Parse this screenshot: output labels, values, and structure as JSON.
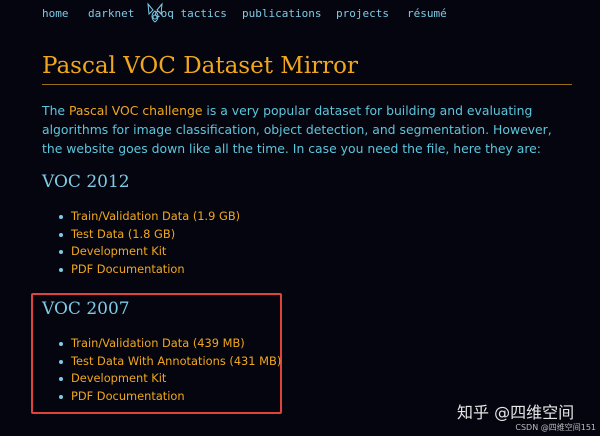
{
  "nav": {
    "items": [
      "home",
      "darknet",
      "coq tactics",
      "publications",
      "projects",
      "résumé"
    ]
  },
  "page": {
    "title": "Pascal VOC Dataset Mirror",
    "intro_prefix": "The ",
    "intro_link": "Pascal VOC challenge",
    "intro_suffix": " is a very popular dataset for building and evaluating algorithms for image classification, object detection, and segmentation. However, the website goes down like all the time. In case you need the file, here they are:"
  },
  "voc2012": {
    "heading": "VOC 2012",
    "links": [
      "Train/Validation Data (1.9 GB)",
      "Test Data (1.8 GB)",
      "Development Kit",
      "PDF Documentation"
    ]
  },
  "voc2007": {
    "heading": "VOC 2007",
    "links": [
      "Train/Validation Data (439 MB)",
      "Test Data With Annotations (431 MB)",
      "Development Kit",
      "PDF Documentation"
    ]
  },
  "watermark": {
    "text": "知乎 @四维空间"
  },
  "credit": {
    "text": "CSDN @四维空间151"
  },
  "colors": {
    "background": "#05050f",
    "accent": "#f0a71d",
    "text": "#5cc6dc",
    "highlight_border": "#e0433b"
  }
}
